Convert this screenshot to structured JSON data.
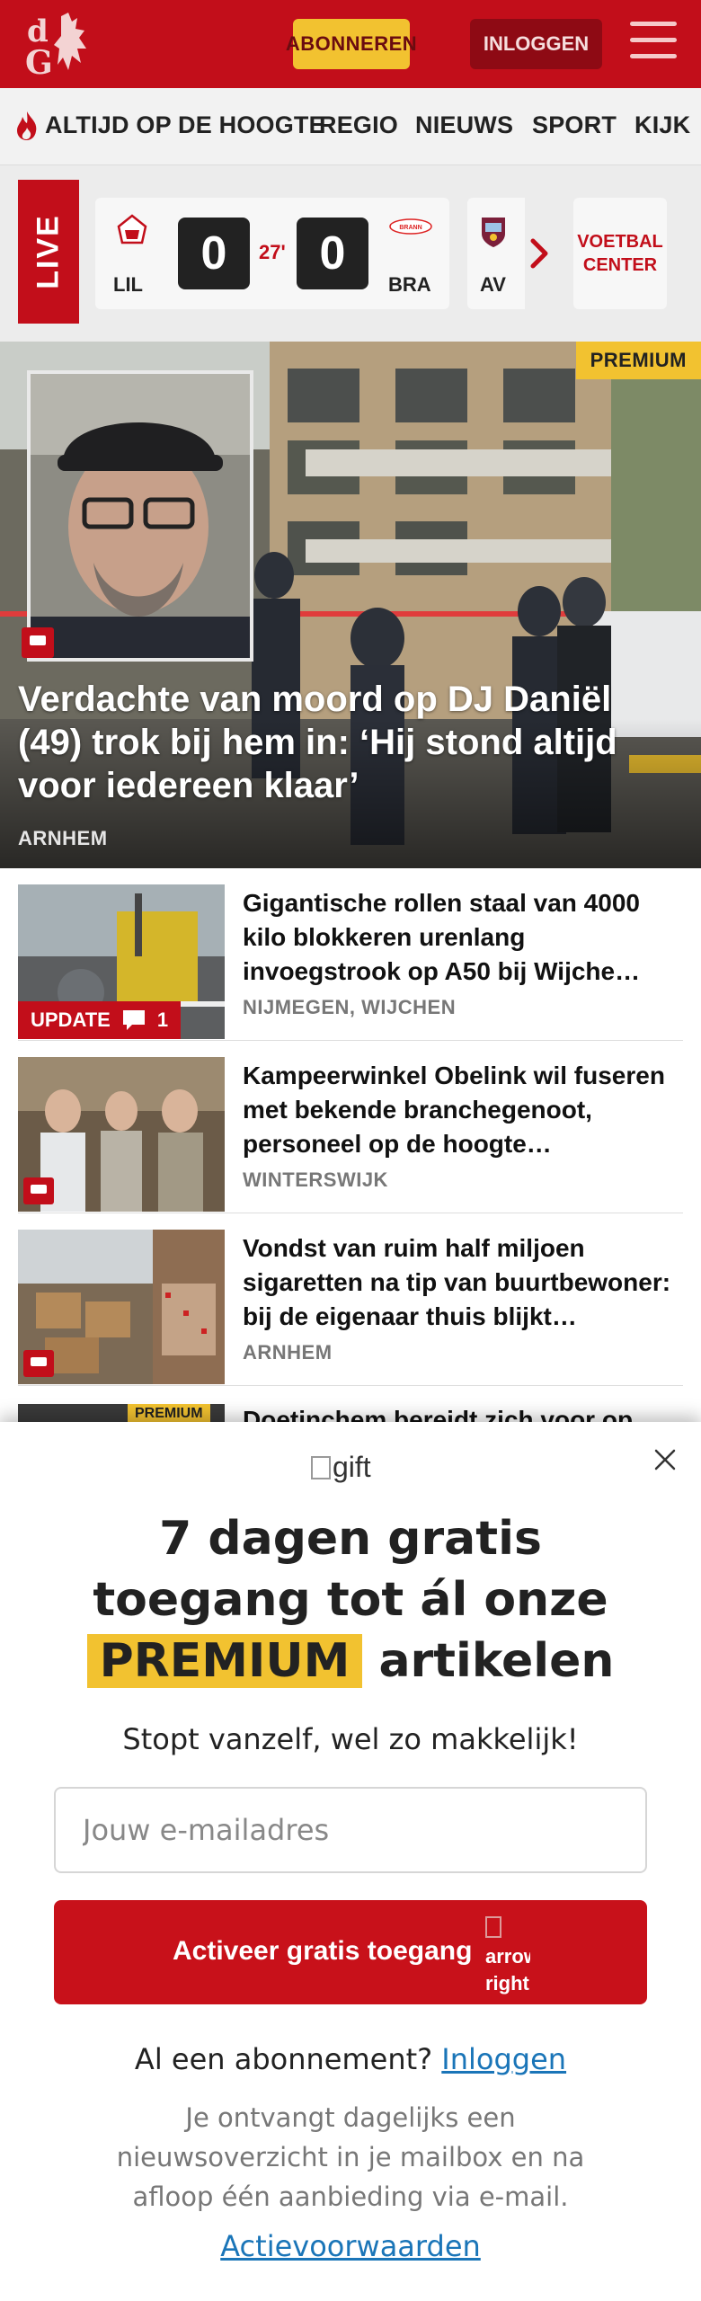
{
  "header": {
    "logo_text": "dG",
    "subscribe_label": "ABONNEREN",
    "login_label": "INLOGGEN",
    "brand_color": "#c20e1a",
    "accent_color": "#f2c230"
  },
  "nav": {
    "items": [
      "ALTIJD OP DE HOOGTE",
      "REGIO",
      "NIEUWS",
      "SPORT",
      "KIJK"
    ]
  },
  "live": {
    "label": "LIVE",
    "match": {
      "home_abbr": "LIL",
      "home_score": "0",
      "minute": "27'",
      "away_score": "0",
      "away_abbr": "BRA",
      "away_crest_text": "BRANN"
    },
    "next_match_abbr": "AV",
    "voetbal_center_label": "VOETBAL CENTER"
  },
  "hero": {
    "badge": "PREMIUM",
    "title": "Verdachte van moord op DJ Daniël (49) trok bij hem in: ‘Hij stond altijd voor iedereen klaar’",
    "location": "ARNHEM"
  },
  "articles": [
    {
      "title": "Gigantische rollen staal van 4000 kilo blokkeren urenlang invoegstrook op A50 bij Wijche…",
      "location": "NIJMEGEN, WIJCHEN",
      "badge": "UPDATE",
      "comment_count": "1"
    },
    {
      "title": "Kampeerwinkel Obelink wil fuseren met bekende branchege­noot, personeel op de hoogte…",
      "location": "WINTERSWIJK"
    },
    {
      "title": "Vondst van ruim half miljoen sigaretten na tip van buurtbewo­ner: bij de eigenaar thuis blijkt…",
      "location": "ARNHEM"
    }
  ],
  "peek": {
    "badge": "PREMIUM",
    "title": "Doetinchem bereidt zich voor op"
  },
  "modal": {
    "gift_alt": "gift",
    "headline_line1": "7 dagen gratis",
    "headline_line2": "toegang tot ál onze",
    "headline_highlight": "PREMIUM",
    "headline_tail": "artikelen",
    "subline": "Stopt vanzelf, wel zo makkelijk!",
    "email_placeholder": "Jouw e-mailadres",
    "activate_label": "Activeer gratis toegang",
    "arrow_alt": "arrow right",
    "have_subscription": "Al een abonnement?",
    "login_link": "Inloggen",
    "info": "Je ontvangt dagelijks een nieuwsoverzicht in je mailbox en na afloop één aanbieding via e-mail.",
    "terms_link": "Actievoorwaarden"
  }
}
